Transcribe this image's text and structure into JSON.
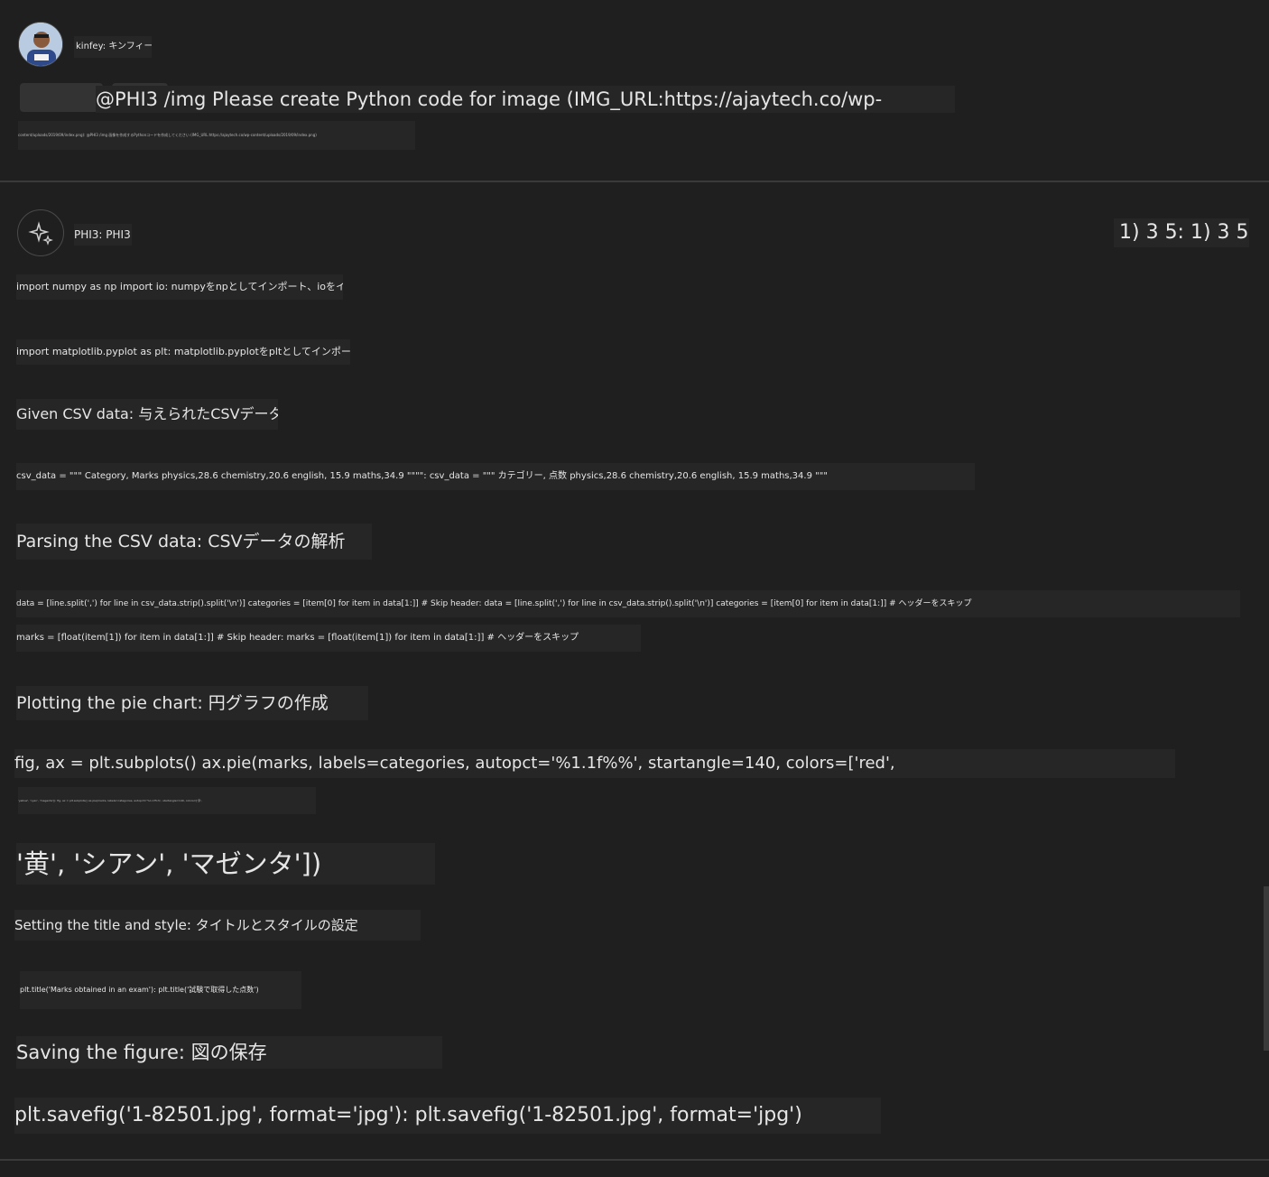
{
  "user": {
    "name": "kinfey: キンフィー",
    "prompt_main": "@PHI3 /img Please create Python code for image (IMG_URL:https://ajaytech.co/wp-",
    "prompt_small": "content/uploads/2019/09/index.png): @PHI3 /img 画像を作成するPythonコードを作成してください (IMG_URL:https://ajaytech.co/wp-content/uploads/2019/09/index.png)"
  },
  "assistant": {
    "name": "PHI3: PHI3",
    "counter": "1) 3 5: 1) 3 5",
    "lines": [
      "import numpy as np import io: numpyをnpとしてインポート、ioをインポート",
      "import matplotlib.pyplot as plt: matplotlib.pyplotをpltとしてインポート",
      "Given CSV data: 与えられたCSVデータ",
      "csv_data = \"\"\" Category, Marks physics,28.6 chemistry,20.6 english, 15.9 maths,34.9 \"\"\"\": csv_data = \"\"\" カテゴリー, 点数 physics,28.6 chemistry,20.6 english, 15.9 maths,34.9 \"\"\"",
      "Parsing the CSV data: CSVデータの解析",
      "data = [line.split(',') for line in csv_data.strip().split('\\n')] categories = [item[0] for item in data[1:]] # Skip header: data = [line.split(',') for line in csv_data.strip().split('\\n')] categories = [item[0] for item in data[1:]] # ヘッダーをスキップ",
      "marks = [float(item[1]) for item in data[1:]] # Skip header: marks = [float(item[1]) for item in data[1:]] # ヘッダーをスキップ",
      "Plotting the pie chart: 円グラフの作成",
      "fig, ax = plt.subplots() ax.pie(marks, labels=categories, autopct='%1.1f%%', startangle=140, colors=['red',",
      "'yellow', 'cyan', 'magenta']): fig, ax = plt.subplots() ax.pie(marks, labels=categories, autopct='%1.1f%%', startangle=140, colors=['赤',",
      "'黄', 'シアン', 'マゼンタ'])",
      "Setting the title and style: タイトルとスタイルの設定",
      "plt.title('Marks obtained in an exam'): plt.title('試験で取得した点数')",
      "Saving the figure: 図の保存",
      "plt.savefig('1-82501.jpg', format='jpg'): plt.savefig('1-82501.jpg', format='jpg')"
    ]
  },
  "icons": {
    "assistant_avatar": "sparkle-icon",
    "user_avatar": "user-photo"
  },
  "colors": {
    "background": "#1f1f1f",
    "block": "#262626",
    "text": "#e6e6e6",
    "divider": "#3a3a3a"
  }
}
